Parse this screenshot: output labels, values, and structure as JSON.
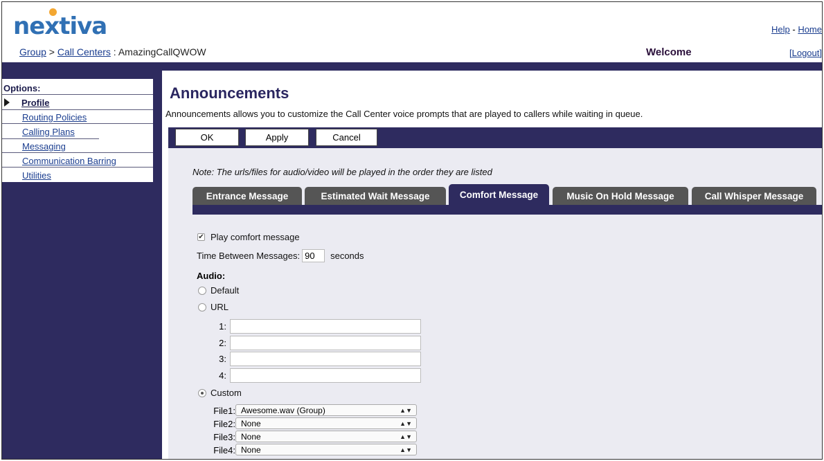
{
  "brand": {
    "logo_text": "nextiva",
    "dot_color": "#f3a732",
    "blue": "#3070b4"
  },
  "breadcrumb": {
    "group": "Group",
    "sep1": " > ",
    "call_centers": "Call Centers",
    "sep2": " : ",
    "current": "AmazingCallQWOW"
  },
  "toplinks": {
    "help": "Help",
    "sep": " - ",
    "home": "Home"
  },
  "welcome": "Welcome",
  "logout": "[Logout]",
  "sidebar": {
    "title": "Options:",
    "items": [
      {
        "label": "Profile",
        "active": true
      },
      {
        "label": "Routing Policies"
      },
      {
        "label": "Calling Plans"
      },
      {
        "label": "Messaging"
      },
      {
        "label": "Communication Barring"
      },
      {
        "label": "Utilities"
      }
    ]
  },
  "page": {
    "title": "Announcements",
    "description": "Announcements allows you to customize the Call Center voice prompts that are played to callers while waiting in queue."
  },
  "buttons": {
    "ok": "OK",
    "apply": "Apply",
    "cancel": "Cancel"
  },
  "note": "Note: The urls/files for audio/video will be played in the order they are listed",
  "tabs": [
    {
      "label": "Entrance Message"
    },
    {
      "label": "Estimated Wait Message"
    },
    {
      "label": "Comfort Message",
      "active": true
    },
    {
      "label": "Music On Hold Message"
    },
    {
      "label": "Call Whisper Message"
    }
  ],
  "form": {
    "play_label": "Play comfort message",
    "play_checked": true,
    "time_label": "Time Between Messages:",
    "time_value": "90",
    "time_unit": "seconds",
    "audio_label": "Audio:",
    "radio_default": "Default",
    "radio_url": "URL",
    "radio_custom": "Custom",
    "url_labels": [
      "1:",
      "2:",
      "3:",
      "4:"
    ],
    "file_labels": [
      "File1:",
      "File2:",
      "File3:",
      "File4:"
    ],
    "file_values": [
      "Awesome.wav (Group)",
      "None",
      "None",
      "None"
    ],
    "selected_audio": "Custom"
  },
  "colors": {
    "navy": "#2e2b5f",
    "tab_gray": "#555555",
    "panel": "#ebebf2"
  }
}
